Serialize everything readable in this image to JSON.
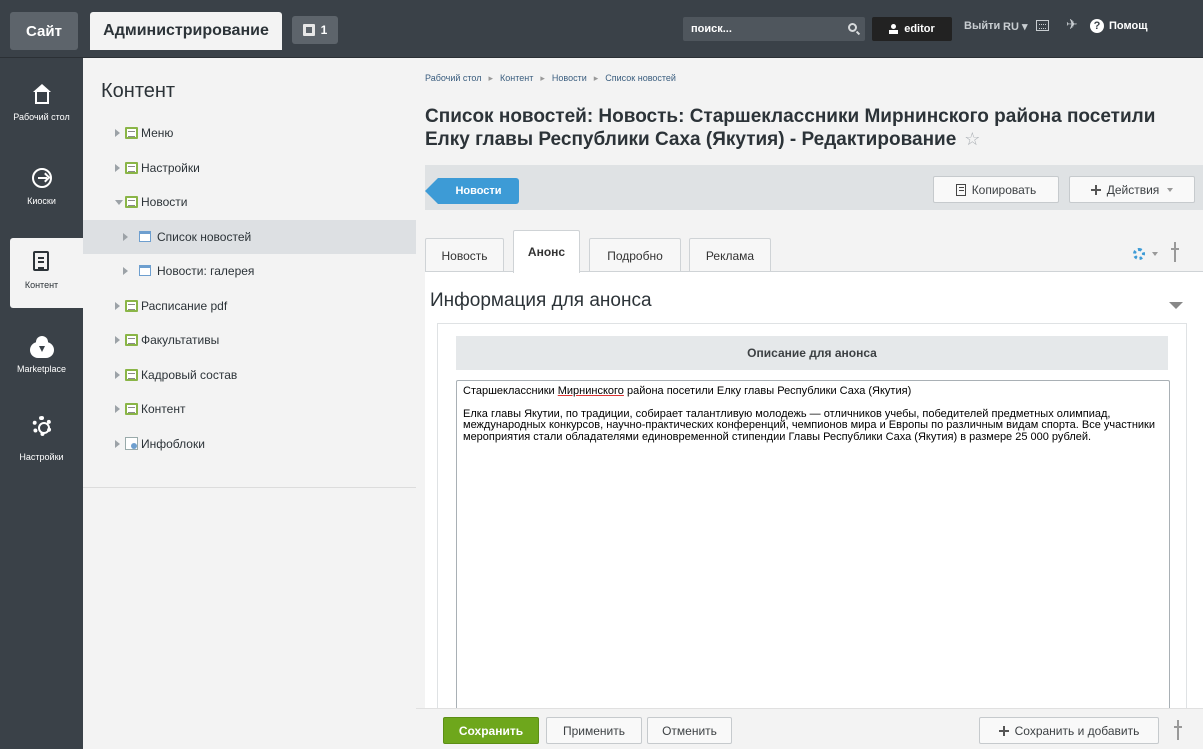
{
  "topbar": {
    "site_label": "Сайт",
    "admin_label": "Администрирование",
    "notify_count": "1",
    "search_placeholder": "поиск...",
    "user_label": "editor",
    "logout_label": "Выйти",
    "lang_label": "RU",
    "help_label": "Помощ"
  },
  "leftmenu": {
    "items": [
      {
        "label": "Рабочий стол",
        "icon": "home-icon"
      },
      {
        "label": "Киоски",
        "icon": "kiosk-icon"
      },
      {
        "label": "Контент",
        "icon": "document-icon",
        "active": true
      },
      {
        "label": "Marketplace",
        "icon": "cloud-icon"
      },
      {
        "label": "Настройки",
        "icon": "gear-icon"
      }
    ]
  },
  "tree": {
    "title": "Контент",
    "items": [
      {
        "label": "Меню"
      },
      {
        "label": "Настройки"
      },
      {
        "label": "Новости"
      },
      {
        "label": "Список новостей"
      },
      {
        "label": "Новости: галерея"
      },
      {
        "label": "Расписание pdf"
      },
      {
        "label": "Факультативы"
      },
      {
        "label": "Кадровый состав"
      },
      {
        "label": "Контент"
      },
      {
        "label": "Инфоблоки"
      }
    ]
  },
  "breadcrumb": [
    "Рабочий стол",
    "Контент",
    "Новости",
    "Список новостей"
  ],
  "page_title": "Список новостей: Новость: Старшеклассники Мирнинского района посетили Елку главы Республики Саха (Якутия) - Редактирование",
  "toolbar": {
    "back_label": "Новости",
    "copy_label": "Копировать",
    "actions_label": "Действия"
  },
  "tabs": [
    "Новость",
    "Анонс",
    "Подробно",
    "Реклама"
  ],
  "section": {
    "title": "Информация для анонса",
    "editor_header": "Описание для анонса",
    "text_p1_a": "Старшеклассники ",
    "text_p1_b": "Мирнинского",
    "text_p1_c": " района посетили Елку главы Республики Саха (Якутия)",
    "text_p2": "Елка главы Якутии, по традиции, собирает талантливую молодежь — отличников учебы, победителей предметных олимпиад, международных конкурсов, научно-практических конференций, чемпионов мира и Европы по различным видам спорта. Все участники мероприятия стали обладателями единовременной стипендии Главы Республики Саха (Якутия) в размере 25 000 рублей."
  },
  "footer": {
    "save_label": "Сохранить",
    "apply_label": "Применить",
    "cancel_label": "Отменить",
    "save_add_label": "Сохранить и добавить"
  }
}
